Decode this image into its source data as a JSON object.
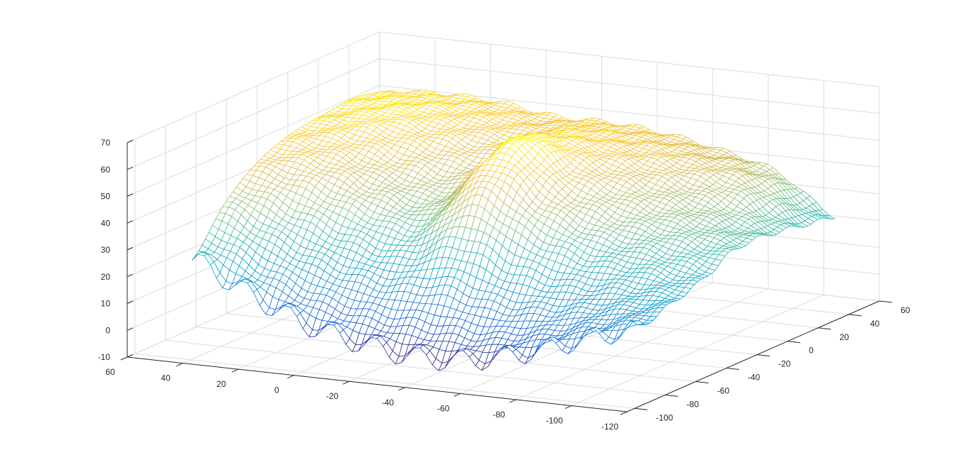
{
  "chart_data": {
    "type": "surface",
    "style": "mesh",
    "colormap": "parula",
    "title": "",
    "xlabel": "",
    "ylabel": "",
    "zlabel": "",
    "grid": true,
    "x_axis": {
      "range": [
        -120,
        60
      ],
      "ticks": [
        "60",
        "40",
        "20",
        "0",
        "-20",
        "-40",
        "-60",
        "-80",
        "-100",
        "-120"
      ],
      "tick_values": [
        60,
        40,
        20,
        0,
        -20,
        -40,
        -60,
        -80,
        -100,
        -120
      ]
    },
    "y_axis": {
      "range": [
        -105,
        60
      ],
      "ticks": [
        "-100",
        "-80",
        "-60",
        "-40",
        "-20",
        "0",
        "20",
        "40",
        "60"
      ],
      "tick_values": [
        -100,
        -80,
        -60,
        -40,
        -20,
        0,
        20,
        40,
        60
      ]
    },
    "z_axis": {
      "range": [
        -10,
        70
      ],
      "ticks": [
        "-10",
        "0",
        "10",
        "20",
        "30",
        "40",
        "50",
        "60",
        "70"
      ],
      "tick_values": [
        -10,
        0,
        10,
        20,
        30,
        40,
        50,
        60,
        70
      ]
    },
    "surface_grid": {
      "x": [
        45,
        25,
        5,
        -15,
        -35,
        -55,
        -75,
        -95,
        -115
      ],
      "y": [
        -90,
        -68,
        -47,
        -25,
        -3,
        18,
        40
      ],
      "z": [
        [
          24,
          14,
          5,
          0,
          -3,
          -2,
          3,
          10,
          16
        ],
        [
          40,
          30,
          22,
          18,
          20,
          15,
          15,
          18,
          20
        ],
        [
          50,
          46,
          38,
          34,
          50,
          38,
          30,
          28,
          24
        ],
        [
          55,
          52,
          45,
          42,
          62,
          48,
          40,
          35,
          30
        ],
        [
          57,
          57,
          52,
          48,
          58,
          52,
          45,
          38,
          30
        ],
        [
          58,
          58,
          55,
          52,
          55,
          52,
          48,
          42,
          28
        ],
        [
          55,
          56,
          55,
          52,
          52,
          50,
          46,
          40,
          26
        ]
      ],
      "z_min": -3,
      "z_max": 62
    }
  }
}
